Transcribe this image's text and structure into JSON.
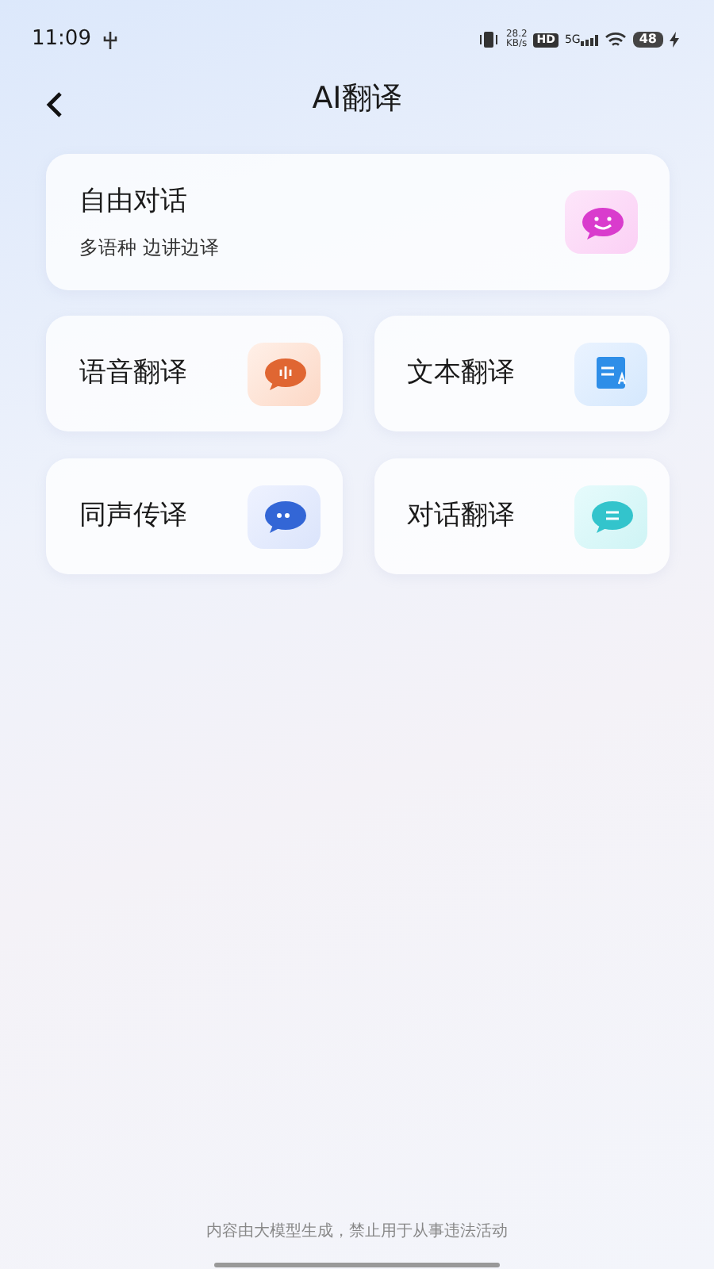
{
  "status_bar": {
    "time": "11:09",
    "speed_value": "28.2",
    "speed_unit": "KB/s",
    "hd": "HD",
    "network": "5G",
    "battery": "48"
  },
  "header": {
    "title": "AI翻译"
  },
  "featured": {
    "title": "自由对话",
    "subtitle": "多语种 边讲边译",
    "kind": "smile"
  },
  "features": [
    {
      "title": "语音翻译",
      "kind": "voice"
    },
    {
      "title": "文本翻译",
      "kind": "text"
    },
    {
      "title": "同声传译",
      "kind": "dots"
    },
    {
      "title": "对话翻译",
      "kind": "lines"
    }
  ],
  "footer": {
    "disclaimer": "内容由大模型生成，禁止用于从事违法活动"
  }
}
